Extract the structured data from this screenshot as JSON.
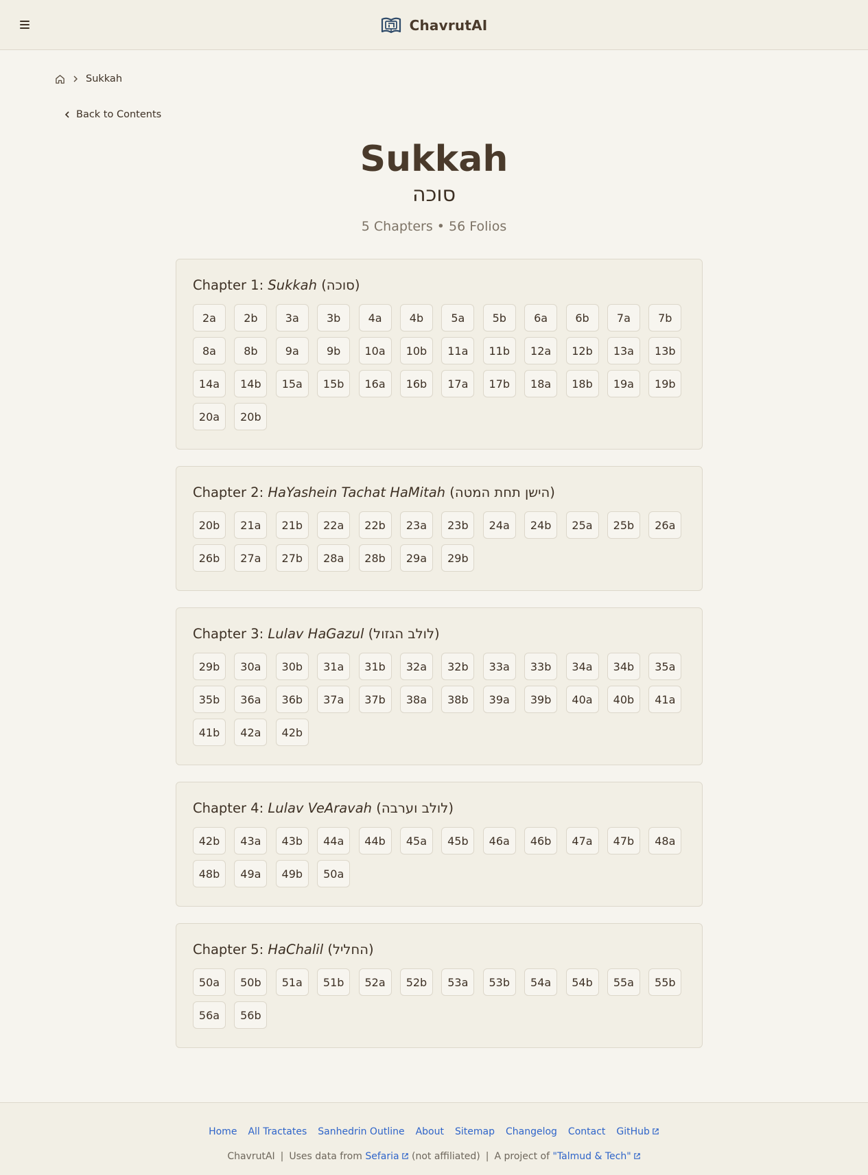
{
  "header": {
    "menu_icon": "hamburger-icon",
    "logo_icon": "book-logo-icon",
    "brand": "ChavrutAI"
  },
  "breadcrumb": {
    "home_icon": "home-icon",
    "separator_icon": "chevron-right-icon",
    "current": "Sukkah"
  },
  "back_link": {
    "label": "Back to Contents",
    "icon": "chevron-left-icon"
  },
  "title": {
    "english": "Sukkah",
    "hebrew": "סוכה",
    "meta": "5 Chapters • 56 Folios"
  },
  "chapters": [
    {
      "prefix": "Chapter 1:",
      "name": "Sukkah",
      "hebrew": "(סוכה)",
      "folios": [
        "2a",
        "2b",
        "3a",
        "3b",
        "4a",
        "4b",
        "5a",
        "5b",
        "6a",
        "6b",
        "7a",
        "7b",
        "8a",
        "8b",
        "9a",
        "9b",
        "10a",
        "10b",
        "11a",
        "11b",
        "12a",
        "12b",
        "13a",
        "13b",
        "14a",
        "14b",
        "15a",
        "15b",
        "16a",
        "16b",
        "17a",
        "17b",
        "18a",
        "18b",
        "19a",
        "19b",
        "20a",
        "20b"
      ]
    },
    {
      "prefix": "Chapter 2:",
      "name": "HaYashein Tachat HaMitah",
      "hebrew": "(הישן תחת המטה)",
      "folios": [
        "20b",
        "21a",
        "21b",
        "22a",
        "22b",
        "23a",
        "23b",
        "24a",
        "24b",
        "25a",
        "25b",
        "26a",
        "26b",
        "27a",
        "27b",
        "28a",
        "28b",
        "29a",
        "29b"
      ]
    },
    {
      "prefix": "Chapter 3:",
      "name": "Lulav HaGazul",
      "hebrew": "(לולב הגזול)",
      "folios": [
        "29b",
        "30a",
        "30b",
        "31a",
        "31b",
        "32a",
        "32b",
        "33a",
        "33b",
        "34a",
        "34b",
        "35a",
        "35b",
        "36a",
        "36b",
        "37a",
        "37b",
        "38a",
        "38b",
        "39a",
        "39b",
        "40a",
        "40b",
        "41a",
        "41b",
        "42a",
        "42b"
      ]
    },
    {
      "prefix": "Chapter 4:",
      "name": "Lulav VeAravah",
      "hebrew": "(לולב וערבה)",
      "folios": [
        "42b",
        "43a",
        "43b",
        "44a",
        "44b",
        "45a",
        "45b",
        "46a",
        "46b",
        "47a",
        "47b",
        "48a",
        "48b",
        "49a",
        "49b",
        "50a"
      ]
    },
    {
      "prefix": "Chapter 5:",
      "name": "HaChalil",
      "hebrew": "(החליל)",
      "folios": [
        "50a",
        "50b",
        "51a",
        "51b",
        "52a",
        "52b",
        "53a",
        "53b",
        "54a",
        "54b",
        "55a",
        "55b",
        "56a",
        "56b"
      ]
    }
  ],
  "footer": {
    "links": [
      "Home",
      "All Tractates",
      "Sanhedrin Outline",
      "About",
      "Sitemap",
      "Changelog",
      "Contact",
      "GitHub"
    ],
    "note": {
      "brand": "ChavrutAI",
      "uses_prefix": "Uses data from",
      "sefaria": "Sefaria",
      "not_affiliated": "(not affiliated)",
      "project_prefix": "A project of",
      "project": "\"Talmud & Tech\""
    }
  },
  "colors": {
    "background": "#f6f4ee",
    "panel": "#f2efe5",
    "text": "#3d3024",
    "link": "#2e64c9"
  }
}
